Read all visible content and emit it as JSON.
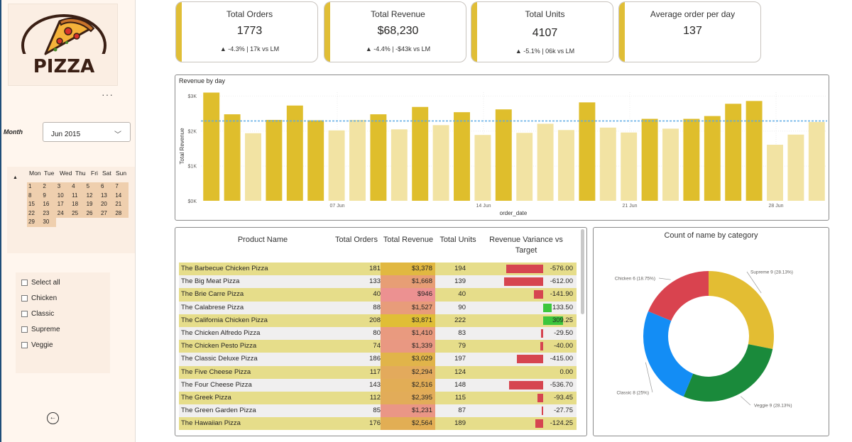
{
  "sidebar": {
    "logo_text": "PIZZA",
    "month_label": "Month",
    "month_value": "Jun 2015",
    "calendar": {
      "weekdays": [
        "Mon",
        "Tue",
        "Wed",
        "Thu",
        "Fri",
        "Sat",
        "Sun"
      ],
      "weeks": [
        [
          "1",
          "2",
          "3",
          "4",
          "5",
          "6",
          "7"
        ],
        [
          "8",
          "9",
          "10",
          "11",
          "12",
          "13",
          "14"
        ],
        [
          "15",
          "16",
          "17",
          "18",
          "19",
          "20",
          "21"
        ],
        [
          "22",
          "23",
          "24",
          "25",
          "26",
          "27",
          "28"
        ],
        [
          "29",
          "30",
          "",
          "",
          "",
          "",
          ""
        ]
      ]
    },
    "categories": [
      "Select all",
      "Chicken",
      "Classic",
      "Supreme",
      "Veggie"
    ]
  },
  "kpis": [
    {
      "title": "Total Orders",
      "value": "1773",
      "sub": "▲ -4.3% | 17k vs LM"
    },
    {
      "title": "Total Revenue",
      "value": "$68,230",
      "sub": "▲ -4.4% | -$43k vs LM"
    },
    {
      "title": "Total Units",
      "value": "4107",
      "sub": "▲ -5.1% | 06k vs LM"
    },
    {
      "title": "Average order per day",
      "value": "137",
      "sub": ""
    }
  ],
  "revenue_chart": {
    "title": "Revenue by day",
    "ylabel": "Total Revenue",
    "xlabel": "order_date",
    "yticks": [
      "$0K",
      "$1K",
      "$2K",
      "$3K"
    ],
    "xticks": [
      "07 Jun",
      "14 Jun",
      "21 Jun",
      "28 Jun"
    ]
  },
  "table": {
    "headers": {
      "name": "Product Name",
      "orders": "Total Orders",
      "revenue": "Total Revenue",
      "units": "Total Units",
      "variance": "Revenue Variance vs Target"
    },
    "rows": [
      {
        "name": "The Barbecue Chicken Pizza",
        "orders": "181",
        "revenue": "$3,378",
        "units": "194",
        "variance": "-576.00"
      },
      {
        "name": "The Big Meat Pizza",
        "orders": "133",
        "revenue": "$1,668",
        "units": "139",
        "variance": "-612.00"
      },
      {
        "name": "The Brie Carre Pizza",
        "orders": "40",
        "revenue": "$946",
        "units": "40",
        "variance": "-141.90"
      },
      {
        "name": "The Calabrese Pizza",
        "orders": "88",
        "revenue": "$1,527",
        "units": "90",
        "variance": "133.50"
      },
      {
        "name": "The California Chicken Pizza",
        "orders": "208",
        "revenue": "$3,871",
        "units": "222",
        "variance": "309.25"
      },
      {
        "name": "The Chicken Alfredo Pizza",
        "orders": "80",
        "revenue": "$1,410",
        "units": "83",
        "variance": "-29.50"
      },
      {
        "name": "The Chicken Pesto Pizza",
        "orders": "74",
        "revenue": "$1,339",
        "units": "79",
        "variance": "-40.00"
      },
      {
        "name": "The Classic Deluxe Pizza",
        "orders": "186",
        "revenue": "$3,029",
        "units": "197",
        "variance": "-415.00"
      },
      {
        "name": "The Five Cheese Pizza",
        "orders": "117",
        "revenue": "$2,294",
        "units": "124",
        "variance": "0.00"
      },
      {
        "name": "The Four Cheese Pizza",
        "orders": "143",
        "revenue": "$2,516",
        "units": "148",
        "variance": "-536.70"
      },
      {
        "name": "The Greek Pizza",
        "orders": "112",
        "revenue": "$2,395",
        "units": "115",
        "variance": "-93.45"
      },
      {
        "name": "The Green Garden Pizza",
        "orders": "85",
        "revenue": "$1,231",
        "units": "87",
        "variance": "-27.75"
      },
      {
        "name": "The Hawaiian Pizza",
        "orders": "176",
        "revenue": "$2,564",
        "units": "189",
        "variance": "-124.25"
      }
    ]
  },
  "donut": {
    "title": "Count of name by category"
  },
  "colors": {
    "bar_dark": "#dfbe2c",
    "bar_light": "#f2e3a3",
    "avg_line": "#5aa9e6",
    "neg_var": "#d64550",
    "pos_var": "#3cc63c",
    "kpi_accent": "#e0be36"
  },
  "chart_data": [
    {
      "type": "bar",
      "title": "Revenue by day",
      "xlabel": "order_date",
      "ylabel": "Total Revenue",
      "x": [
        "1 Jun",
        "2 Jun",
        "3 Jun",
        "4 Jun",
        "5 Jun",
        "6 Jun",
        "7 Jun",
        "8 Jun",
        "9 Jun",
        "10 Jun",
        "11 Jun",
        "12 Jun",
        "13 Jun",
        "14 Jun",
        "15 Jun",
        "16 Jun",
        "17 Jun",
        "18 Jun",
        "19 Jun",
        "20 Jun",
        "21 Jun",
        "22 Jun",
        "23 Jun",
        "24 Jun",
        "25 Jun",
        "26 Jun",
        "27 Jun",
        "28 Jun",
        "29 Jun",
        "30 Jun"
      ],
      "values": [
        3090,
        2470,
        1930,
        2310,
        2720,
        2300,
        2010,
        2310,
        2470,
        2040,
        2680,
        2160,
        2530,
        1880,
        2610,
        1940,
        2200,
        2020,
        2810,
        2090,
        1950,
        2340,
        2060,
        2340,
        2420,
        2770,
        2850,
        1600,
        1890,
        2250
      ],
      "average": 2280,
      "ylim": [
        0,
        3100
      ],
      "yticks": [
        "$0K",
        "$1K",
        "$2K",
        "$3K"
      ],
      "grid": true
    },
    {
      "type": "pie",
      "title": "Count of name by category",
      "labels": [
        "Supreme",
        "Veggie",
        "Classic",
        "Chicken"
      ],
      "values": [
        9,
        9,
        8,
        6
      ],
      "label_text": [
        "Supreme 9 (28.13%)",
        "Veggie 9 (28.13%)",
        "Classic 8 (25%)",
        "Chicken 6 (18.75%)"
      ],
      "colors": [
        "#e3bd33",
        "#1a8a3b",
        "#138df5",
        "#d9434f"
      ]
    }
  ]
}
